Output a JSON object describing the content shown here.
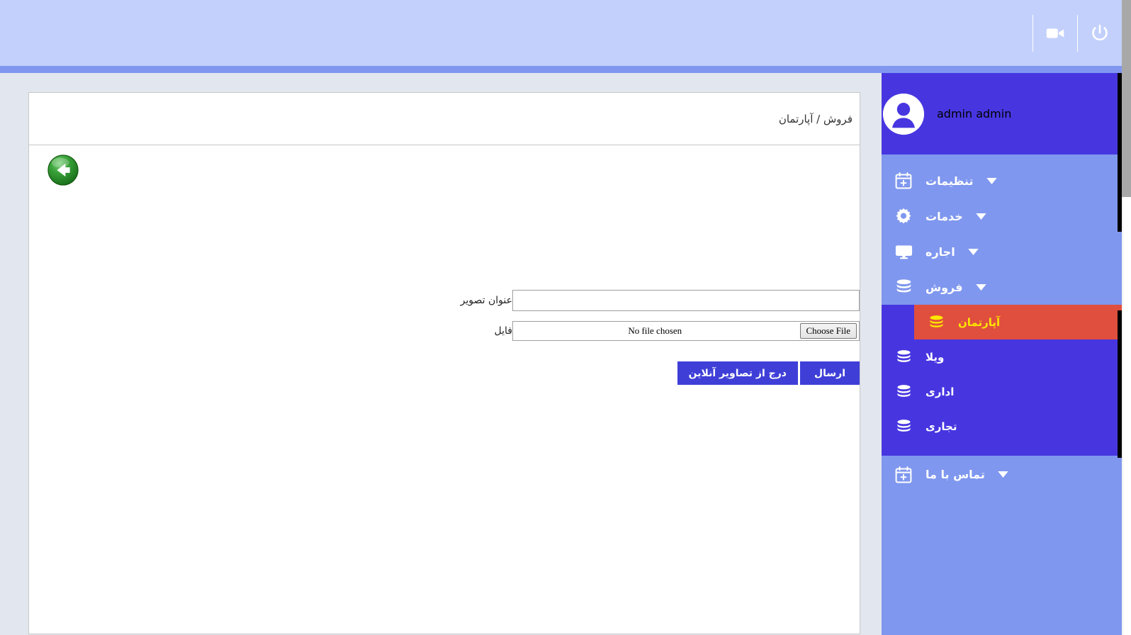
{
  "topbar": {
    "icons": [
      {
        "name": "power-icon",
        "label": "Power"
      },
      {
        "name": "video-camera-icon",
        "label": "Video"
      }
    ]
  },
  "sidebar": {
    "user": {
      "name": "admin admin",
      "avatar_icon": "user-avatar-icon"
    },
    "menu": [
      {
        "label": "تنظیمات",
        "icon": "calendar-plus-icon",
        "caret": "▼",
        "expanded": false
      },
      {
        "label": "خدمات",
        "icon": "gear-icon",
        "caret": "▼",
        "expanded": false
      },
      {
        "label": "اجاره",
        "icon": "monitor-icon",
        "caret": "▼",
        "expanded": false
      },
      {
        "label": "فروش",
        "icon": "database-icon",
        "caret": "▼",
        "expanded": true
      }
    ],
    "submenu": [
      {
        "label": "آپارتمان",
        "icon": "database-icon",
        "active": true
      },
      {
        "label": "ویلا",
        "icon": "database-icon",
        "active": false
      },
      {
        "label": "اداری",
        "icon": "database-icon",
        "active": false
      },
      {
        "label": "تجاری",
        "icon": "database-icon",
        "active": false
      }
    ],
    "menu_bottom": [
      {
        "label": "تماس با ما",
        "icon": "calendar-plus-icon",
        "caret": "▼",
        "expanded": false
      }
    ],
    "colors": {
      "header_bg": "#4736e0",
      "group_bg": "#7f97ee",
      "submenu_bg": "#4736e0",
      "active_bg": "#e04f3e",
      "active_text": "#ffe500"
    }
  },
  "content": {
    "breadcrumb": "فروش / آپارتمان",
    "back_button": "back-arrow-button",
    "form": {
      "fields": [
        {
          "label": "عنوان تصویر",
          "type": "text",
          "value": "",
          "placeholder": ""
        },
        {
          "label": "فایل",
          "type": "file",
          "choose_label": "Choose File",
          "status": "No file chosen"
        }
      ],
      "buttons": [
        {
          "label": "ارسال",
          "kind": "primary"
        },
        {
          "label": "درج از تصاویر آنلاین",
          "kind": "secondary"
        }
      ]
    }
  },
  "colors": {
    "topbar": "#c2d0fb",
    "topbar_underline": "#8097f0",
    "page_bg": "#e2e6ee",
    "button": "#3f3fd8",
    "scrollbar_thumb": "#a8a8a8"
  }
}
